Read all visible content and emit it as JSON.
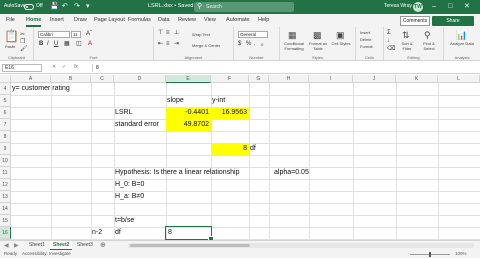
{
  "titlebar": {
    "autosave_label": "AutoSave",
    "autosave_state": "Off",
    "document_name": "LSRL.xlsx • Saved",
    "search_placeholder": "Search",
    "user_name": "Teresa Wray",
    "user_initials": "TW"
  },
  "ribbon": {
    "tabs": [
      "File",
      "Home",
      "Insert",
      "Draw",
      "Page Layout",
      "Formulas",
      "Data",
      "Review",
      "View",
      "Automate",
      "Help"
    ],
    "active_tab": "Home",
    "share_label": "Share",
    "comments_label": "Comments",
    "groups": {
      "clipboard": "Clipboard",
      "font": "Font",
      "alignment": "Alignment",
      "number": "Number",
      "styles": "Styles",
      "cells": "Cells",
      "editing": "Editing",
      "analysis": "Analysis"
    },
    "paste_label": "Paste",
    "font_name": "Calibri",
    "font_size": "11",
    "wrap_text_label": "Wrap Text",
    "merge_label": "Merge & Center",
    "number_format": "General",
    "conditional_label": "Conditional Formatting",
    "format_table_label": "Format as Table",
    "cell_styles_label": "Cell Styles",
    "insert_label": "Insert",
    "delete_label": "Delete",
    "format_label": "Format",
    "sort_label": "Sort & Filter",
    "find_label": "Find & Select",
    "analyze_label": "Analyze Data"
  },
  "formula_bar": {
    "name_box": "E16",
    "fx_label": "fx",
    "value": "8"
  },
  "grid": {
    "columns": [
      "A",
      "B",
      "C",
      "D",
      "E",
      "F",
      "G",
      "H",
      "I",
      "J",
      "K",
      "L"
    ],
    "rows": [
      "4",
      "5",
      "6",
      "7",
      "8",
      "9",
      "10",
      "11",
      "12",
      "13",
      "14",
      "15",
      "16",
      "17"
    ],
    "selected_column": "E",
    "selected_row": "16",
    "cells": {
      "a4": "y= customer rating",
      "d5": "slope",
      "f5": "y-int",
      "d6": "LSRL",
      "e6": "-0.4401",
      "f6": "16.9563",
      "d7": "standard error",
      "e7": "49.8702",
      "f9": "8",
      "g9": "df",
      "d11": "Hypothesis: Is there a linear relationship",
      "h11": "alpha=0.05",
      "d12": "H_0: B=0",
      "d13": "H_a: B≠0",
      "d15": "t=b/se",
      "c16": "n-2",
      "d16": "df",
      "e16": "8",
      "d17": "p-value"
    }
  },
  "sheets": {
    "tabs": [
      "Sheet1",
      "Sheet2",
      "Sheet3"
    ],
    "active": "Sheet2"
  },
  "status": {
    "ready": "Ready",
    "accessibility": "Accessibility: Investigate",
    "zoom": "100%"
  }
}
